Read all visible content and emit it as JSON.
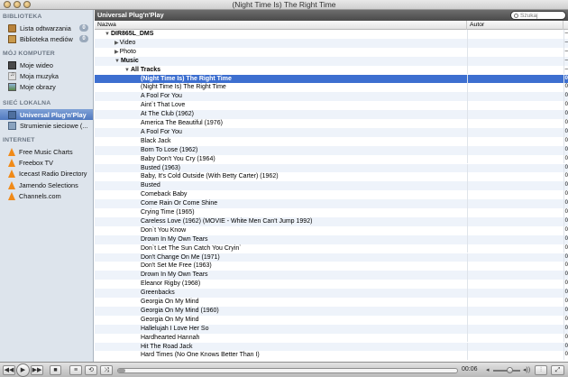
{
  "window": {
    "title": "(Night Time Is) The Right Time"
  },
  "search": {
    "placeholder": "Szukaj"
  },
  "sidebar": {
    "sections": [
      {
        "header": "BIBLIOTEKA",
        "items": [
          {
            "label": "Lista odtwarzania",
            "icon": "playlist-icon",
            "badge": "0"
          },
          {
            "label": "Biblioteka mediów",
            "icon": "media-library-icon",
            "badge": "0"
          }
        ]
      },
      {
        "header": "MÓJ KOMPUTER",
        "items": [
          {
            "label": "Moje wideo",
            "icon": "video-icon"
          },
          {
            "label": "Moja muzyka",
            "icon": "music-icon"
          },
          {
            "label": "Moje obrazy",
            "icon": "pictures-icon"
          }
        ]
      },
      {
        "header": "SIEĆ LOKALNA",
        "items": [
          {
            "label": "Universal Plug'n'Play",
            "icon": "upnp-icon",
            "selected": true
          },
          {
            "label": "Strumienie sieciowe (...",
            "icon": "network-stream-icon"
          }
        ]
      },
      {
        "header": "INTERNET",
        "items": [
          {
            "label": "Free Music Charts",
            "icon": "vlc-cone-icon"
          },
          {
            "label": "Freebox TV",
            "icon": "vlc-cone-icon"
          },
          {
            "label": "Icecast Radio Directory",
            "icon": "vlc-cone-icon"
          },
          {
            "label": "Jamendo Selections",
            "icon": "vlc-cone-icon"
          },
          {
            "label": "Channels.com",
            "icon": "vlc-cone-icon"
          }
        ]
      }
    ]
  },
  "main": {
    "header": "Universal Plug'n'Play",
    "columns": {
      "name": "Nazwa",
      "author": "Autor"
    },
    "tree": [
      {
        "label": "DIR865L_DMS",
        "level": 0,
        "expanded": true
      },
      {
        "label": "Video",
        "level": 1,
        "expanded": false
      },
      {
        "label": "Photo",
        "level": 1,
        "expanded": false
      },
      {
        "label": "Music",
        "level": 1,
        "expanded": true
      },
      {
        "label": "All Tracks",
        "level": 2,
        "expanded": true
      }
    ],
    "tracks": [
      {
        "title": "(Night Time Is) The Right Time",
        "selected": true
      },
      {
        "title": "(Night Time Is) The Right Time"
      },
      {
        "title": "A Fool For You"
      },
      {
        "title": "Aint`t That Love"
      },
      {
        "title": "At The Club (1962)"
      },
      {
        "title": "America The Beautiful (1976)"
      },
      {
        "title": "A Fool For You"
      },
      {
        "title": "Black Jack"
      },
      {
        "title": "Born To Lose (1962)"
      },
      {
        "title": "Baby Don't You Cry (1964)"
      },
      {
        "title": "Busted (1963)"
      },
      {
        "title": "Baby, It's Cold Outside (With Betty Carter) (1962)"
      },
      {
        "title": "Busted"
      },
      {
        "title": "Comeback Baby"
      },
      {
        "title": "Come Rain Or Come Shine"
      },
      {
        "title": "Crying Time (1965)"
      },
      {
        "title": "Careless Love (1962) (MOVIE - White Men Can't Jump 1992)"
      },
      {
        "title": "Don`t You Know"
      },
      {
        "title": "Drown In My Own Tears"
      },
      {
        "title": "Don`t Let The Sun Catch You Cryin`"
      },
      {
        "title": "Don't Change On Me (1971)"
      },
      {
        "title": "Don't Set Me Free (1963)"
      },
      {
        "title": "Drown In My Own Tears"
      },
      {
        "title": "Eleanor Rigby (1968)"
      },
      {
        "title": "Greenbacks"
      },
      {
        "title": "Georgia On My Mind"
      },
      {
        "title": "Georgia On My Mind (1960)"
      },
      {
        "title": "Georgia On My Mind"
      },
      {
        "title": "Hallelujah I Love Her So"
      },
      {
        "title": "Hardhearted Hannah"
      },
      {
        "title": "Hit The Road Jack"
      },
      {
        "title": "Hard Times (No One Knows Better Than I)"
      }
    ]
  },
  "player": {
    "time": "00:06",
    "progress": 0.02,
    "volume": 0.6
  }
}
